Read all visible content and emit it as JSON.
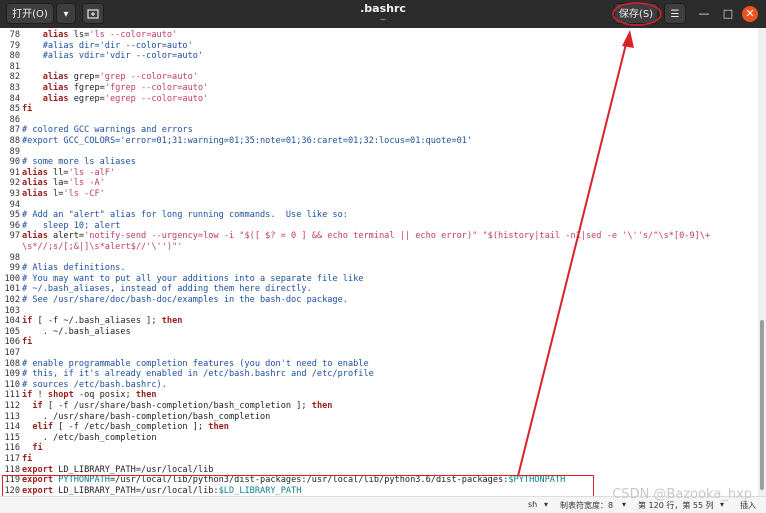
{
  "titlebar": {
    "open_label": "打开(O)",
    "title": ".bashrc",
    "subtitle": "~",
    "save_label": "保存(S)"
  },
  "lines": [
    {
      "n": "78",
      "segs": [
        {
          "t": "    "
        },
        {
          "t": "alias",
          "c": "k"
        },
        {
          "t": " ls="
        },
        {
          "t": "'ls --color=auto'",
          "c": "s"
        }
      ]
    },
    {
      "n": "79",
      "segs": [
        {
          "t": "    #alias dir='dir --color=auto'",
          "c": "c"
        }
      ]
    },
    {
      "n": "80",
      "segs": [
        {
          "t": "    #alias vdir='vdir --color=auto'",
          "c": "c"
        }
      ]
    },
    {
      "n": "81",
      "segs": []
    },
    {
      "n": "82",
      "segs": [
        {
          "t": "    "
        },
        {
          "t": "alias",
          "c": "k"
        },
        {
          "t": " grep="
        },
        {
          "t": "'grep --color=auto'",
          "c": "s"
        }
      ]
    },
    {
      "n": "83",
      "segs": [
        {
          "t": "    "
        },
        {
          "t": "alias",
          "c": "k"
        },
        {
          "t": " fgrep="
        },
        {
          "t": "'fgrep --color=auto'",
          "c": "s"
        }
      ]
    },
    {
      "n": "84",
      "segs": [
        {
          "t": "    "
        },
        {
          "t": "alias",
          "c": "k"
        },
        {
          "t": " egrep="
        },
        {
          "t": "'egrep --color=auto'",
          "c": "s"
        }
      ]
    },
    {
      "n": "85",
      "segs": [
        {
          "t": "fi",
          "c": "k"
        }
      ]
    },
    {
      "n": "86",
      "segs": []
    },
    {
      "n": "87",
      "segs": [
        {
          "t": "# colored GCC warnings and errors",
          "c": "c"
        }
      ]
    },
    {
      "n": "88",
      "segs": [
        {
          "t": "#export GCC_COLORS='error=01;31:warning=01;35:note=01;36:caret=01;32:locus=01:quote=01'",
          "c": "c"
        }
      ]
    },
    {
      "n": "89",
      "segs": []
    },
    {
      "n": "90",
      "segs": [
        {
          "t": "# some more ls aliases",
          "c": "c"
        }
      ]
    },
    {
      "n": "91",
      "segs": [
        {
          "t": "alias",
          "c": "k"
        },
        {
          "t": " ll="
        },
        {
          "t": "'ls -alF'",
          "c": "s"
        }
      ]
    },
    {
      "n": "92",
      "segs": [
        {
          "t": "alias",
          "c": "k"
        },
        {
          "t": " la="
        },
        {
          "t": "'ls -A'",
          "c": "s"
        }
      ]
    },
    {
      "n": "93",
      "segs": [
        {
          "t": "alias",
          "c": "k"
        },
        {
          "t": " l="
        },
        {
          "t": "'ls -CF'",
          "c": "s"
        }
      ]
    },
    {
      "n": "94",
      "segs": []
    },
    {
      "n": "95",
      "segs": [
        {
          "t": "# Add an \"alert\" alias for long running commands.  Use like so:",
          "c": "c"
        }
      ]
    },
    {
      "n": "96",
      "segs": [
        {
          "t": "#   sleep 10; alert",
          "c": "c"
        }
      ]
    },
    {
      "n": "97",
      "segs": [
        {
          "t": "alias",
          "c": "k"
        },
        {
          "t": " alert="
        },
        {
          "t": "'notify-send --urgency=low -i \"$([ $? = 0 ] && echo terminal || echo error)\" \"$(history|tail -n1|sed -e '\\''s/^\\s*[0-9]\\+",
          "c": "s"
        }
      ]
    },
    {
      "n": "",
      "segs": [
        {
          "t": "\\s*//;s/[;&|]\\s*alert$//'\\'')\"'",
          "c": "s"
        }
      ]
    },
    {
      "n": "98",
      "segs": []
    },
    {
      "n": "99",
      "segs": [
        {
          "t": "# Alias definitions.",
          "c": "c"
        }
      ]
    },
    {
      "n": "100",
      "segs": [
        {
          "t": "# You may want to put all your additions into a separate file like",
          "c": "c"
        }
      ]
    },
    {
      "n": "101",
      "segs": [
        {
          "t": "# ~/.bash_aliases, instead of adding them here directly.",
          "c": "c"
        }
      ]
    },
    {
      "n": "102",
      "segs": [
        {
          "t": "# See /usr/share/doc/bash-doc/examples in the bash-doc package.",
          "c": "c"
        }
      ]
    },
    {
      "n": "103",
      "segs": []
    },
    {
      "n": "104",
      "segs": [
        {
          "t": "if",
          "c": "k"
        },
        {
          "t": " [ -f ~/.bash_aliases ]; "
        },
        {
          "t": "then",
          "c": "k"
        }
      ]
    },
    {
      "n": "105",
      "segs": [
        {
          "t": "    . ~/.bash_aliases"
        }
      ]
    },
    {
      "n": "106",
      "segs": [
        {
          "t": "fi",
          "c": "k"
        }
      ]
    },
    {
      "n": "107",
      "segs": []
    },
    {
      "n": "108",
      "segs": [
        {
          "t": "# enable programmable completion features (you don't need to enable",
          "c": "c"
        }
      ]
    },
    {
      "n": "109",
      "segs": [
        {
          "t": "# this, if it's already enabled in /etc/bash.bashrc and /etc/profile",
          "c": "c"
        }
      ]
    },
    {
      "n": "110",
      "segs": [
        {
          "t": "# sources /etc/bash.bashrc).",
          "c": "c"
        }
      ]
    },
    {
      "n": "111",
      "segs": [
        {
          "t": "if",
          "c": "k"
        },
        {
          "t": " ! "
        },
        {
          "t": "shopt",
          "c": "k"
        },
        {
          "t": " -oq posix; "
        },
        {
          "t": "then",
          "c": "k"
        }
      ]
    },
    {
      "n": "112",
      "segs": [
        {
          "t": "  "
        },
        {
          "t": "if",
          "c": "k"
        },
        {
          "t": " [ -f /usr/share/bash-completion/bash_completion ]; "
        },
        {
          "t": "then",
          "c": "k"
        }
      ]
    },
    {
      "n": "113",
      "segs": [
        {
          "t": "    . /usr/share/bash-completion/bash_completion"
        }
      ]
    },
    {
      "n": "114",
      "segs": [
        {
          "t": "  "
        },
        {
          "t": "elif",
          "c": "k"
        },
        {
          "t": " [ -f /etc/bash_completion ]; "
        },
        {
          "t": "then",
          "c": "k"
        }
      ]
    },
    {
      "n": "115",
      "segs": [
        {
          "t": "    . /etc/bash_completion"
        }
      ]
    },
    {
      "n": "116",
      "segs": [
        {
          "t": "  "
        },
        {
          "t": "fi",
          "c": "k"
        }
      ]
    },
    {
      "n": "117",
      "segs": [
        {
          "t": "fi",
          "c": "k"
        }
      ]
    },
    {
      "n": "118",
      "segs": [
        {
          "t": "export",
          "c": "k"
        },
        {
          "t": " LD_LIBRARY_PATH=/usr/local/lib"
        }
      ]
    },
    {
      "n": "119",
      "segs": [
        {
          "t": "export",
          "c": "k"
        },
        {
          "t": " "
        },
        {
          "t": "PYTHONPATH",
          "c": "v"
        },
        {
          "t": "=/usr/local/lib/python3/dist-packages:/usr/local/lib/python3.6/dist-packages:"
        },
        {
          "t": "$PYTHONPATH",
          "c": "v"
        }
      ]
    },
    {
      "n": "120",
      "segs": [
        {
          "t": "export",
          "c": "k"
        },
        {
          "t": " LD_LIBRARY_PATH=/usr/local/lib:"
        },
        {
          "t": "$LD_LIBRARY_PATH",
          "c": "v"
        }
      ]
    }
  ],
  "statusbar": {
    "language": "sh",
    "tab_width": "制表符宽度：8",
    "cursor": "第 120 行，第 55 列",
    "mode": "插入"
  },
  "watermark": "CSDN @Bazooka_hxp",
  "colors": {
    "keyword": "#9b2020",
    "comment": "#1b4f9e",
    "string": "#c03b66",
    "variable": "#0f7f8c",
    "highlight": "#d6232a"
  }
}
